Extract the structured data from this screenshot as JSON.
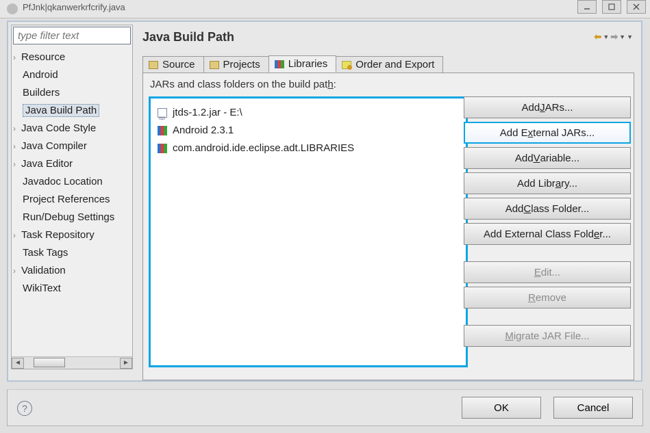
{
  "window": {
    "title_blur": "PfJnk|qkanwerkrfcrify.java"
  },
  "filter": {
    "placeholder": "type filter text"
  },
  "nav": {
    "items": [
      {
        "label": "Resource",
        "caret": true
      },
      {
        "label": "Android"
      },
      {
        "label": "Builders"
      },
      {
        "label": "Java Build Path",
        "selected": true
      },
      {
        "label": "Java Code Style",
        "caret": true
      },
      {
        "label": "Java Compiler",
        "caret": true
      },
      {
        "label": "Java Editor",
        "caret": true
      },
      {
        "label": "Javadoc Location"
      },
      {
        "label": "Project References"
      },
      {
        "label": "Run/Debug Settings"
      },
      {
        "label": "Task Repository",
        "caret": true
      },
      {
        "label": "Task Tags"
      },
      {
        "label": "Validation",
        "caret": true
      },
      {
        "label": "WikiText"
      }
    ]
  },
  "page": {
    "heading": "Java Build Path",
    "tabs": {
      "source": "Source",
      "projects": "Projects",
      "libraries": "Libraries",
      "order": "Order and Export"
    },
    "list_label_pre": "JARs and class folders on the build pat",
    "list_label_u": "h",
    "list_label_post": ":",
    "entries": [
      {
        "icon": "jar",
        "label": "jtds-1.2.jar - E:\\"
      },
      {
        "icon": "books",
        "label": "Android 2.3.1"
      },
      {
        "icon": "books",
        "label": "com.android.ide.eclipse.adt.LIBRARIES"
      }
    ],
    "buttons": {
      "add_jars": {
        "pre": "Add ",
        "u": "J",
        "post": "ARs..."
      },
      "add_ext_jars": {
        "pre": "Add E",
        "u": "x",
        "post": "ternal JARs..."
      },
      "add_variable": {
        "pre": "Add ",
        "u": "V",
        "post": "ariable..."
      },
      "add_library": {
        "pre": "Add Libr",
        "u": "a",
        "post": "ry..."
      },
      "add_class_folder": {
        "pre": "Add ",
        "u": "C",
        "post": "lass Folder..."
      },
      "add_ext_class_folder": {
        "pre": "Add External Class Fold",
        "u": "e",
        "post": "r..."
      },
      "edit": {
        "pre": "",
        "u": "E",
        "post": "dit..."
      },
      "remove": {
        "pre": "",
        "u": "R",
        "post": "emove"
      },
      "migrate": {
        "pre": "",
        "u": "M",
        "post": "igrate JAR File..."
      }
    }
  },
  "dialog": {
    "ok": "OK",
    "cancel": "Cancel"
  }
}
